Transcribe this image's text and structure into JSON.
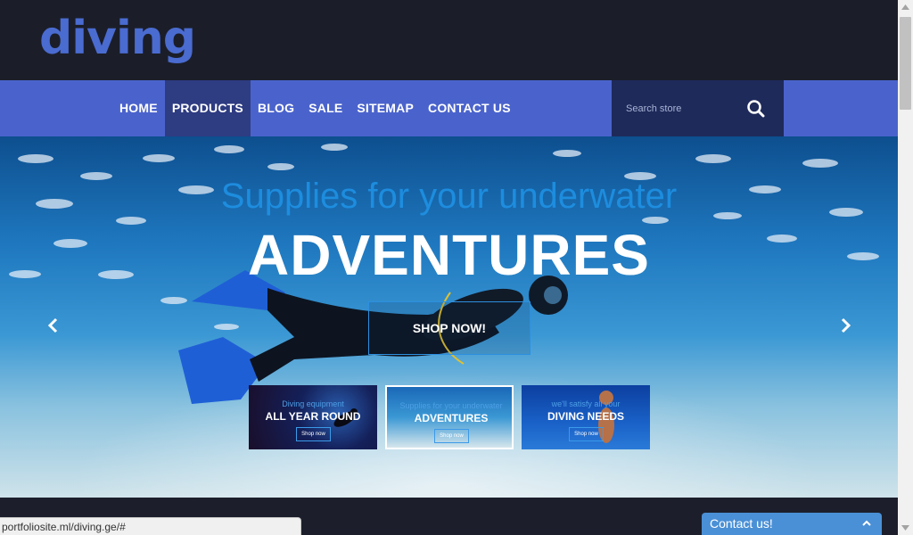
{
  "header": {
    "logo_text": "diving"
  },
  "nav": {
    "items": [
      {
        "label": "HOME",
        "active": false
      },
      {
        "label": "PRODUCTS",
        "active": true
      },
      {
        "label": "BLOG",
        "active": false
      },
      {
        "label": "SALE",
        "active": false
      },
      {
        "label": "SITEMAP",
        "active": false
      },
      {
        "label": "CONTACT US",
        "active": false
      }
    ],
    "search": {
      "placeholder": "Search store",
      "icon": "search-icon"
    }
  },
  "hero": {
    "subtitle": "Supplies for your underwater",
    "title": "ADVENTURES",
    "button_label": "SHOP NOW!",
    "prev_icon": "chevron-left-icon",
    "next_icon": "chevron-right-icon",
    "thumbnails": [
      {
        "subtitle": "Diving equipment",
        "title": "ALL YEAR ROUND",
        "button": "Shop now"
      },
      {
        "subtitle": "Supplies for your underwater",
        "title": "ADVENTURES",
        "button": "Shop now"
      },
      {
        "subtitle": "we'll satisfy all your",
        "title": "DIVING NEEDS",
        "button": "Shop now"
      }
    ]
  },
  "status_bar": {
    "url": "portfoliosite.ml/diving.ge/#"
  },
  "contact_widget": {
    "label": "Contact us!",
    "icon": "chevron-up-icon"
  },
  "colors": {
    "header_bg": "#1b1e29",
    "nav_bg": "#4a63cc",
    "nav_active": "#2e3c82",
    "search_bg": "#1e2a5a",
    "logo": "#4a6bd0",
    "accent": "#1f94e8",
    "contact_bg": "#4a90d6"
  }
}
